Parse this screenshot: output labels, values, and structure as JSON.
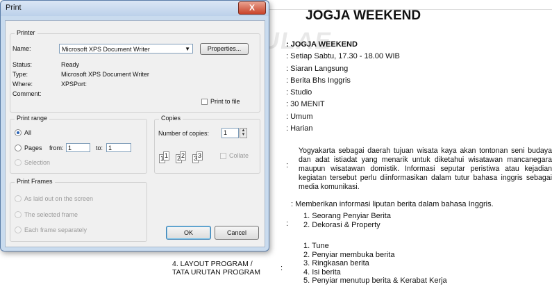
{
  "document": {
    "title": "JOGJA WEEKEND",
    "watermark": "SCHULAE",
    "lines": [
      ": JOGJA WEEKEND",
      ": Setiap Sabtu, 17.30 - 18.00 WIB",
      ": Siaran Langsung",
      ": Berita Bhs Inggris",
      ": Studio",
      ": 30 MENIT",
      ": Umum",
      ": Harian"
    ],
    "paragraph": "Yogyakarta sebagai daerah tujuan wisata kaya akan tontonan seni budaya dan adat istiadat  yang menarik untuk diketahui wisatawan mancanegara maupun wisatawan domistik. Informasi seputar peristiwa atau kejadian kegiatan tersebut perlu diinformasikan dalam tutur bahasa inggris sebagai media komunikasi.",
    "objective": ": Memberikan informasi liputan berita dalam bahasa Inggris.",
    "support_list": [
      "1.  Seorang Penyiar Berita",
      "2.  Dekorasi & Property"
    ],
    "program_list": [
      "1.  Tune",
      "2.  Penyiar membuka berita",
      "3.  Ringkasan berita",
      "4.  Isi berita",
      "5.  Penyiar menutup  berita & Kerabat Kerja"
    ],
    "layout_label_line1": "4. LAYOUT PROGRAM /",
    "layout_label_line2": "TATA URUTAN PROGRAM",
    "colon": ":"
  },
  "dialog": {
    "title": "Print",
    "close_label": "X",
    "printer": {
      "group_label": "Printer",
      "name_label": "Name:",
      "name_value": "Microsoft XPS Document Writer",
      "properties_label": "Properties...",
      "status_label": "Status:",
      "status_value": "Ready",
      "type_label": "Type:",
      "type_value": "Microsoft XPS Document Writer",
      "where_label": "Where:",
      "where_value": "XPSPort:",
      "comment_label": "Comment:",
      "print_to_file_label": "Print to file"
    },
    "print_range": {
      "group_label": "Print range",
      "all_label": "All",
      "pages_label": "Pages",
      "from_label": "from:",
      "from_value": "1",
      "to_label": "to:",
      "to_value": "1",
      "selection_label": "Selection"
    },
    "copies": {
      "group_label": "Copies",
      "number_label": "Number of copies:",
      "number_value": "1",
      "collate_label": "Collate"
    },
    "frames": {
      "group_label": "Print Frames",
      "opt1": "As laid out on the screen",
      "opt2": "The selected frame",
      "opt3": "Each frame separately"
    },
    "ok_label": "OK",
    "cancel_label": "Cancel"
  }
}
